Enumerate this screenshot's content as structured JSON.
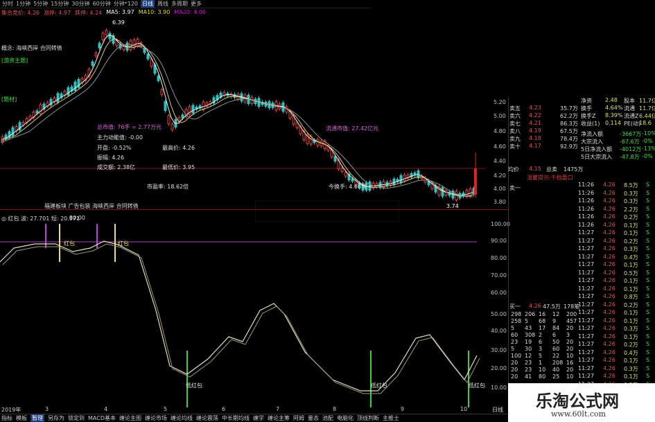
{
  "toolbar": {
    "periods": [
      "分时",
      "1分钟",
      "5分钟",
      "15分钟",
      "30分钟",
      "60分钟",
      "日线",
      "周线",
      "多周期",
      "更多"
    ],
    "active_period": "日线",
    "extra": "分钟*120"
  },
  "ma_line": {
    "items": [
      {
        "label": "集合竞价: 4.26",
        "color": "#e05050"
      },
      {
        "label": "涨停: 4.97",
        "color": "#e05050"
      },
      {
        "label": "跌停: 4.24",
        "color": "#e05050"
      },
      {
        "label": "MA5: 3.97",
        "color": "#ffffff"
      },
      {
        "label": "MA10: 3.90",
        "color": "#e0e000"
      },
      {
        "label": "MA20: 4.06",
        "color": "#e000e0"
      }
    ]
  },
  "main_chart": {
    "concept": "概念: 海峡西岸 合同转债",
    "tag1": "[游资主题]",
    "tag2": "[题材]",
    "high_label": "6.39",
    "low_label": "3.74",
    "annotations": [
      {
        "text": "最高价: 4.26",
        "color": "#e0e0e0"
      },
      {
        "text": "最低价: 3.95",
        "color": "#e0e0e0"
      },
      {
        "text": "市盈率: 18.62倍",
        "color": "#e0e0e0"
      },
      {
        "text": "流通市值: 27.42亿元",
        "color": "#e060e0"
      },
      {
        "text": "今换手: 4.66%",
        "color": "#e0e0e0"
      }
    ],
    "info_box": {
      "lines": [
        {
          "text": "总市值: 76手 = 2.77万元",
          "color": "#e060e0"
        },
        {
          "text": "主力动能值: -0.00",
          "color": "#e0e0e0"
        },
        {
          "text": "开盘: -0.52%",
          "color": "#e0e0e0"
        },
        {
          "text": "振幅: 4.26",
          "color": "#e0e0e0"
        },
        {
          "text": "成交额: 2.38亿",
          "color": "#e0e0e0"
        }
      ]
    }
  },
  "indicator": {
    "header": "福建板块 广告包装 海峡西岸 合同转债",
    "legend": "◎ 红包 波: 27.701  短: 20.971",
    "legend2": "80.00",
    "marks_top": [
      "红包",
      "红包"
    ],
    "marks_bottom": [
      "低红包",
      "低红包",
      "低红包"
    ],
    "axis": [
      "100.00",
      "90.00",
      "80.00",
      "70.00",
      "60.00",
      "50.00",
      "40.00",
      "30.00",
      "20.00",
      "10.00"
    ]
  },
  "price_axis": [
    "5.20",
    "5.00",
    "4.80",
    "4.60",
    "4.40",
    "4.20",
    "4.00",
    "3.80"
  ],
  "x_axis": [
    "2019年",
    "3",
    "4",
    "5",
    "6",
    "7",
    "8",
    "9",
    "10"
  ],
  "order_book": {
    "asks": [
      {
        "label": "卖五",
        "price": "4.23",
        "vol": "35.7万"
      },
      {
        "label": "卖六",
        "price": "4.22",
        "vol": "62.2万"
      },
      {
        "label": "卖七",
        "price": "4.21",
        "vol": "86.3万"
      },
      {
        "label": "卖八",
        "price": "4.19",
        "vol": "67.5万"
      },
      {
        "label": "卖九",
        "price": "4.18",
        "vol": "78.4万"
      },
      {
        "label": "卖十",
        "price": "4.17",
        "vol": "92.9万"
      }
    ],
    "avg_label": "均价",
    "avg_val": "4.15",
    "total_sell": "总卖",
    "total_sell_val": "1475万",
    "note": "温馨提示:千档盘口",
    "buy_one": {
      "label": "买一",
      "price": "4.26",
      "vol": "47.5万",
      "count": "178笔"
    }
  },
  "stats": [
    {
      "label": "净资",
      "val": "2.48",
      "label2": "股本",
      "val2": "11.7亿"
    },
    {
      "label": "换手",
      "val": "4.64%",
      "label2": "流通",
      "val2": "11.7亿"
    },
    {
      "label": "换手Z",
      "val": "8.39%",
      "label2": "流通Z",
      "val2": "6.44亿"
    },
    {
      "label": "收益(1)",
      "val": "0.114",
      "label2": "PE(动)",
      "val2": "18.6"
    }
  ],
  "flows": [
    {
      "label": "净流入额",
      "val": "-3667万",
      "pct": "-10%"
    },
    {
      "label": "大宗流入",
      "val": "-67.6万",
      "pct": "-0%"
    },
    {
      "label": "5日净流入额",
      "val": "-4012万",
      "pct": "-13%"
    },
    {
      "label": "5日大宗流入",
      "val": "-47.8万",
      "pct": "-0%"
    }
  ],
  "sell_one": "卖一",
  "ticks": [
    {
      "t": "11:26",
      "p": "4.26",
      "v": "8.5万",
      "s": "S"
    },
    {
      "t": "11:26",
      "p": "4.26",
      "v": "0.3万",
      "s": "S"
    },
    {
      "t": "11:26",
      "p": "4.26",
      "v": "0.3万",
      "s": "S"
    },
    {
      "t": "11:26",
      "p": "4.26",
      "v": "2.2万",
      "s": "S"
    },
    {
      "t": "11:26",
      "p": "4.26",
      "v": "0.2万",
      "s": "S"
    },
    {
      "t": "11:26",
      "p": "4.26",
      "v": "0.1万",
      "s": "S"
    },
    {
      "t": "11:27",
      "p": "4.26",
      "v": "0.1万",
      "s": "S"
    },
    {
      "t": "11:27",
      "p": "4.26",
      "v": "0.2万",
      "s": "S"
    },
    {
      "t": "11:27",
      "p": "4.26",
      "v": "0.3万",
      "s": "S"
    },
    {
      "t": "11:27",
      "p": "4.26",
      "v": "0.4万",
      "s": "S"
    },
    {
      "t": "11:27",
      "p": "4.26",
      "v": "0.1万",
      "s": "S"
    },
    {
      "t": "11:27",
      "p": "4.26",
      "v": "0.5万",
      "s": "S"
    },
    {
      "t": "11:27",
      "p": "4.26",
      "v": "0.1万",
      "s": "S"
    },
    {
      "t": "11:27",
      "p": "4.26",
      "v": "0.1万",
      "s": "S"
    },
    {
      "t": "11:27",
      "p": "4.26",
      "v": "0.8万",
      "s": "S"
    },
    {
      "t": "11:27",
      "p": "4.26",
      "v": "0.2万",
      "s": "S"
    },
    {
      "t": "11:27",
      "p": "4.26",
      "v": "0.1万",
      "s": "S"
    },
    {
      "t": "11:27",
      "p": "4.26",
      "v": "0.1万",
      "s": "S"
    },
    {
      "t": "11:27",
      "p": "4.26",
      "v": "0.3万",
      "s": "S"
    },
    {
      "t": "11:27",
      "p": "4.26",
      "v": "0.1万",
      "s": "S"
    },
    {
      "t": "11:27",
      "p": "4.26",
      "v": "0.2万",
      "s": "S"
    },
    {
      "t": "11:27",
      "p": "4.26",
      "v": "0.4万",
      "s": "S"
    },
    {
      "t": "11:27",
      "p": "4.26",
      "v": "0.1万",
      "s": "S"
    },
    {
      "t": "11:27",
      "p": "4.26",
      "v": "0.3万",
      "s": "S"
    },
    {
      "t": "11:27",
      "p": "4.26",
      "v": "0.1万",
      "s": "S"
    },
    {
      "t": "11:27",
      "p": "4.26",
      "v": "0.2万",
      "s": "S"
    },
    {
      "t": "11:27",
      "p": "4.26",
      "v": "0.1万",
      "s": "S"
    },
    {
      "t": "11:27",
      "p": "4.26",
      "v": "0.2万",
      "s": "S"
    }
  ],
  "queue": [
    [
      "298",
      "206",
      "16",
      "12",
      "200"
    ],
    [
      "258",
      "5",
      "68",
      "9",
      "457"
    ],
    [
      "5",
      "43",
      "17",
      "84",
      "20"
    ],
    [
      "60",
      "308",
      "2",
      "6",
      "3"
    ],
    [
      "23",
      "19",
      "6",
      "50",
      "20"
    ],
    [
      "5",
      "30",
      "3",
      "60",
      "20"
    ],
    [
      "100",
      "12",
      "5",
      "22",
      "10"
    ],
    [
      "20",
      "23",
      "1",
      "208",
      "16"
    ],
    [
      "20",
      "23",
      "10",
      "40",
      "20"
    ],
    [
      "20",
      "41",
      "80",
      "25",
      "10"
    ]
  ],
  "bottom_tabs": [
    "指标",
    "模板",
    "暂理",
    "另存为",
    "锁定到",
    "MACD基本",
    "缠论主图",
    "缠论市场",
    "缠论均线",
    "缠论震荡",
    "中长期均线",
    "缠学",
    "缠论主筹",
    "阿姆",
    "量态",
    "池配",
    "电脑化",
    "顶线判断",
    "主推士"
  ],
  "bottom_active": "暂理",
  "right_tab": "日线",
  "watermark": {
    "title": "乐淘公式网",
    "url": "www.60lt.com"
  }
}
